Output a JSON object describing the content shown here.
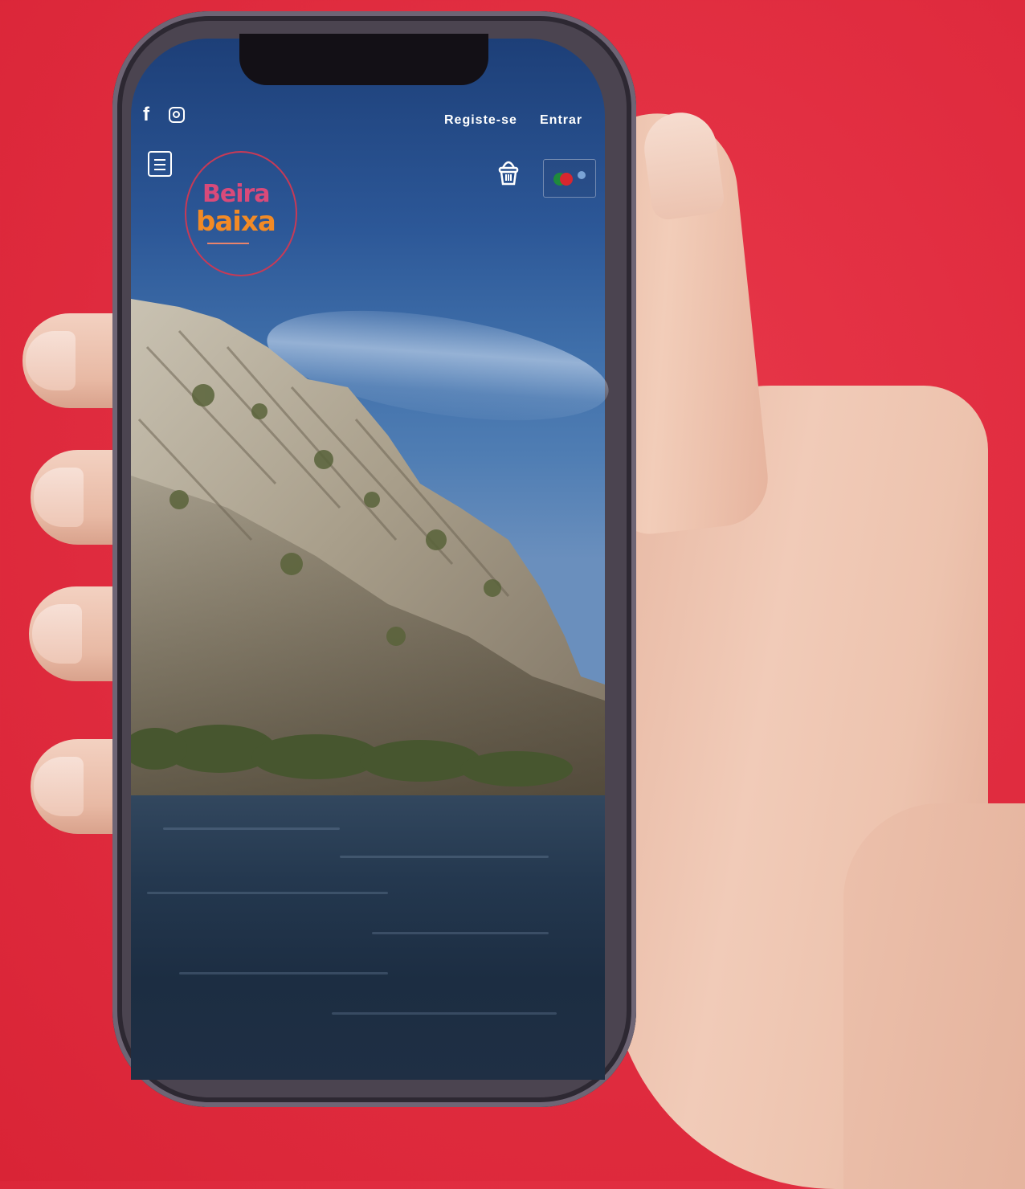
{
  "header": {
    "register_label": "Registe-se",
    "login_label": "Entrar"
  },
  "logo": {
    "line1": "Beira",
    "line2": "baixa"
  },
  "icons": {
    "social": [
      "facebook-icon",
      "instagram-icon"
    ],
    "menu": "hamburger-menu-icon",
    "cart": "basket-icon",
    "language": "portugal-flag-icon"
  },
  "colors": {
    "background": "#e02c3f",
    "logo_pink": "#d94a7a",
    "logo_orange": "#f28a25",
    "header_text": "#ffffff"
  }
}
